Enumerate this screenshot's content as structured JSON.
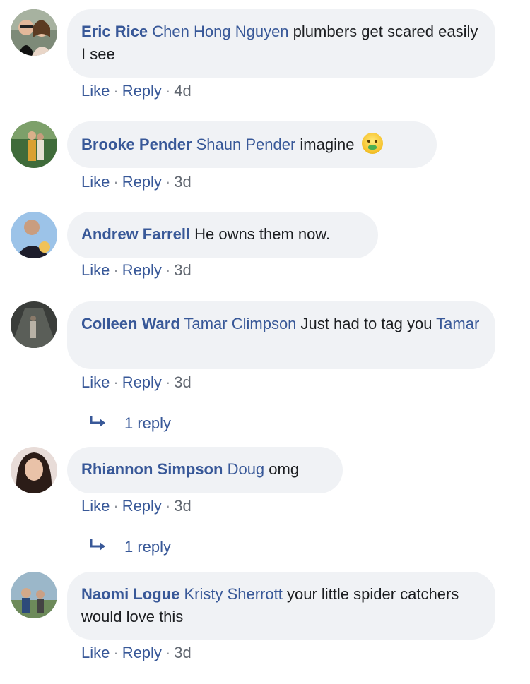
{
  "comments": [
    {
      "author": "Eric Rice",
      "tag": "Chen Hong Nguyen",
      "text": "plumbers get scared easily I see",
      "like": "Like",
      "reply": "Reply",
      "time": "4d"
    },
    {
      "author": "Brooke Pender",
      "tag": "Shaun Pender",
      "text": "imagine",
      "emoji": "nauseated-face-emoji",
      "like": "Like",
      "reply": "Reply",
      "time": "3d"
    },
    {
      "author": "Andrew Farrell",
      "tag": "",
      "text": "He owns them now.",
      "like": "Like",
      "reply": "Reply",
      "time": "3d"
    },
    {
      "author": "Colleen Ward",
      "tag": "Tamar Climpson",
      "text": "Just had to tag you",
      "tag2": "Tamar",
      "like": "Like",
      "reply": "Reply",
      "time": "3d",
      "replies": "1 reply"
    },
    {
      "author": "Rhiannon Simpson",
      "tag": "Doug",
      "text": "omg",
      "like": "Like",
      "reply": "Reply",
      "time": "3d",
      "replies": "1 reply"
    },
    {
      "author": "Naomi Logue",
      "tag": "Kristy Sherrott",
      "text": "your little spider catchers would love this",
      "like": "Like",
      "reply": "Reply",
      "time": "3d"
    }
  ],
  "separator": "·",
  "colors": {
    "link": "#385898",
    "bubble": "#f0f2f5",
    "meta": "#616770"
  },
  "icons": {
    "reply_arrow": "reply-arrow-icon"
  }
}
